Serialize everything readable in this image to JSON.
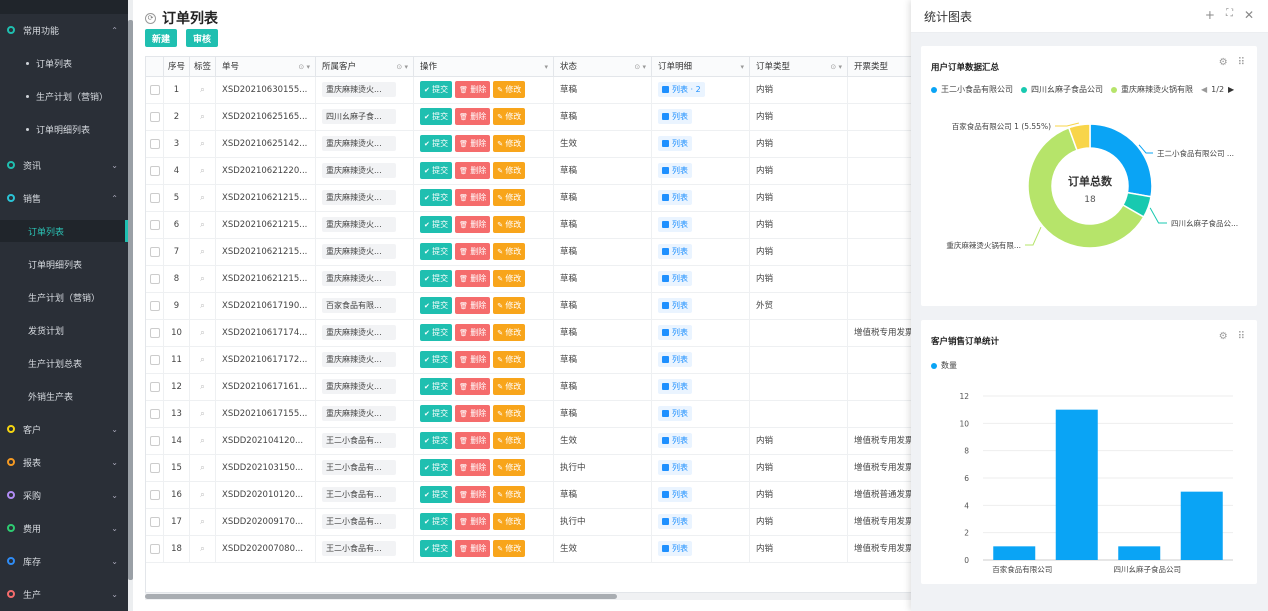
{
  "sidebar": {
    "groups": [
      {
        "label": "常用功能",
        "color": "#1fbfb0",
        "expanded": true
      },
      {
        "label": "资讯",
        "color": "#1fbfb0"
      },
      {
        "label": "销售",
        "color": "#2bc4d6",
        "expanded": true
      },
      {
        "label": "客户",
        "color": "#f5d511"
      },
      {
        "label": "报表",
        "color": "#f59a23"
      },
      {
        "label": "采购",
        "color": "#b18cf5"
      },
      {
        "label": "费用",
        "color": "#2ecc71"
      },
      {
        "label": "库存",
        "color": "#2f8cf5"
      },
      {
        "label": "生产",
        "color": "#f56c6c"
      }
    ],
    "common_items": [
      "订单列表",
      "生产计划（营销）",
      "订单明细列表"
    ],
    "sales_items": [
      "订单列表",
      "订单明细列表",
      "生产计划（营销）",
      "发货计划",
      "生产计划总表",
      "外销生产表"
    ],
    "active_item": "订单列表"
  },
  "page": {
    "title": "订单列表",
    "new_label": "新建",
    "audit_label": "审核"
  },
  "table": {
    "headers": {
      "seq": "序号",
      "tag": "标签",
      "no": "单号",
      "customer": "所属客户",
      "op": "操作",
      "status": "状态",
      "detail": "订单明细",
      "type": "订单类型",
      "invoice": "开票类型"
    },
    "op_labels": {
      "submit": "提交",
      "delete": "删除",
      "modify": "修改"
    },
    "list_label": "列表",
    "rows": [
      {
        "seq": "1",
        "no": "XSD20210630155...",
        "customer": "重庆麻辣烫火...",
        "status": "草稿",
        "detail": "列表 · 2",
        "type": "内销",
        "invoice": ""
      },
      {
        "seq": "2",
        "no": "XSD20210625165...",
        "customer": "四川幺麻子食...",
        "status": "草稿",
        "detail": "列表",
        "type": "内销",
        "invoice": ""
      },
      {
        "seq": "3",
        "no": "XSD20210625142...",
        "customer": "重庆麻辣烫火...",
        "status": "生效",
        "detail": "列表",
        "type": "内销",
        "invoice": ""
      },
      {
        "seq": "4",
        "no": "XSD20210621220...",
        "customer": "重庆麻辣烫火...",
        "status": "草稿",
        "detail": "列表",
        "type": "内销",
        "invoice": ""
      },
      {
        "seq": "5",
        "no": "XSD20210621215...",
        "customer": "重庆麻辣烫火...",
        "status": "草稿",
        "detail": "列表",
        "type": "内销",
        "invoice": ""
      },
      {
        "seq": "6",
        "no": "XSD20210621215...",
        "customer": "重庆麻辣烫火...",
        "status": "草稿",
        "detail": "列表",
        "type": "内销",
        "invoice": ""
      },
      {
        "seq": "7",
        "no": "XSD20210621215...",
        "customer": "重庆麻辣烫火...",
        "status": "草稿",
        "detail": "列表",
        "type": "内销",
        "invoice": ""
      },
      {
        "seq": "8",
        "no": "XSD20210621215...",
        "customer": "重庆麻辣烫火...",
        "status": "草稿",
        "detail": "列表",
        "type": "内销",
        "invoice": ""
      },
      {
        "seq": "9",
        "no": "XSD20210617190...",
        "customer": "百家食品有限...",
        "status": "草稿",
        "detail": "列表",
        "type": "外贸",
        "invoice": ""
      },
      {
        "seq": "10",
        "no": "XSD20210617174...",
        "customer": "重庆麻辣烫火...",
        "status": "草稿",
        "detail": "列表",
        "type": "",
        "invoice": "增值税专用发票"
      },
      {
        "seq": "11",
        "no": "XSD20210617172...",
        "customer": "重庆麻辣烫火...",
        "status": "草稿",
        "detail": "列表",
        "type": "",
        "invoice": ""
      },
      {
        "seq": "12",
        "no": "XSD20210617161...",
        "customer": "重庆麻辣烫火...",
        "status": "草稿",
        "detail": "列表",
        "type": "",
        "invoice": ""
      },
      {
        "seq": "13",
        "no": "XSD20210617155...",
        "customer": "重庆麻辣烫火...",
        "status": "草稿",
        "detail": "列表",
        "type": "",
        "invoice": ""
      },
      {
        "seq": "14",
        "no": "XSDD202104120...",
        "customer": "王二小食品有...",
        "status": "生效",
        "detail": "列表",
        "type": "内销",
        "invoice": "增值税专用发票"
      },
      {
        "seq": "15",
        "no": "XSDD202103150...",
        "customer": "王二小食品有...",
        "status": "执行中",
        "detail": "列表",
        "type": "内销",
        "invoice": "增值税专用发票"
      },
      {
        "seq": "16",
        "no": "XSDD202010120...",
        "customer": "王二小食品有...",
        "status": "草稿",
        "detail": "列表",
        "type": "内销",
        "invoice": "增值税普通发票"
      },
      {
        "seq": "17",
        "no": "XSDD202009170...",
        "customer": "王二小食品有...",
        "status": "执行中",
        "detail": "列表",
        "type": "内销",
        "invoice": "增值税专用发票"
      },
      {
        "seq": "18",
        "no": "XSDD202007080...",
        "customer": "王二小食品有...",
        "status": "生效",
        "detail": "列表",
        "type": "内销",
        "invoice": "增值税专用发票"
      }
    ]
  },
  "panel": {
    "title": "统计图表"
  },
  "chart_data": [
    {
      "type": "pie",
      "title": "用户订单数据汇总",
      "center_label": "订单总数",
      "center_value": "18",
      "legend_page": "1/2",
      "legend": [
        "王二小食品有限公司",
        "四川幺麻子食品公司",
        "重庆麻辣烫火锅有限"
      ],
      "slices": [
        {
          "label": "王二小食品有限公司 ...",
          "value": 5,
          "color": "#0aa4f5"
        },
        {
          "label": "四川幺麻子食品公...",
          "value": 1,
          "color": "#18c9b0"
        },
        {
          "label": "重庆麻辣烫火锅有限...",
          "value": 11,
          "color": "#b6e46a"
        },
        {
          "label": "百家食品有限公司 1 (5.55%)",
          "value": 1,
          "color": "#f8d54a"
        }
      ]
    },
    {
      "type": "bar",
      "title": "客户销售订单统计",
      "series": [
        {
          "name": "数量",
          "values": [
            1,
            11,
            1,
            5
          ],
          "color": "#0aa4f5"
        }
      ],
      "tick_labels": [
        "百家食品有限公司",
        "四川幺麻子食品公司"
      ],
      "ylim": [
        0,
        12
      ],
      "yticks": [
        "0",
        "2",
        "4",
        "6",
        "8",
        "10",
        "12"
      ]
    }
  ]
}
